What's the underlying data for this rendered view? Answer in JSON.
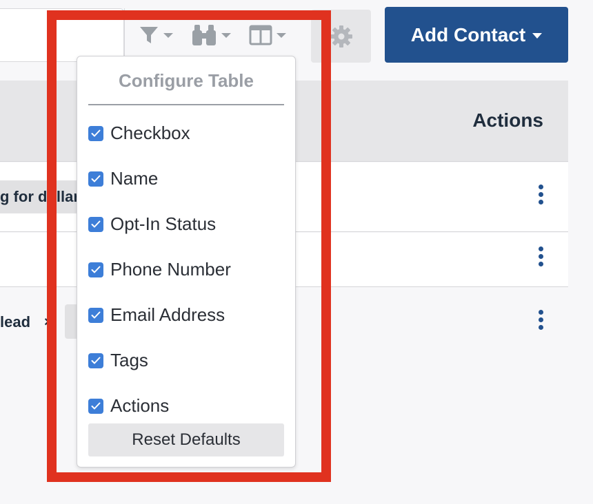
{
  "toolbar": {
    "search_placeholder": "",
    "filter_icon": "filter-icon",
    "search_icon": "binoculars-icon",
    "columns_icon": "columns-icon",
    "settings_icon": "gear-icon",
    "add_contact_label": "Add Contact"
  },
  "table": {
    "actions_header": "Actions",
    "rows": [
      {
        "tag": "g for dollar"
      },
      {
        "tag": ""
      },
      {
        "tag": "lead",
        "remove": "×"
      }
    ]
  },
  "config_table": {
    "title": "Configure Table",
    "options": [
      {
        "label": "Checkbox",
        "checked": true
      },
      {
        "label": "Name",
        "checked": true
      },
      {
        "label": "Opt-In Status",
        "checked": true
      },
      {
        "label": "Phone Number",
        "checked": true
      },
      {
        "label": "Email Address",
        "checked": true
      },
      {
        "label": "Tags",
        "checked": true
      },
      {
        "label": "Actions",
        "checked": true
      }
    ],
    "reset_label": "Reset Defaults"
  },
  "colors": {
    "primary": "#22518e",
    "checkbox": "#3d7ed8",
    "highlight": "#e0321f",
    "muted": "#9a9ea5"
  }
}
